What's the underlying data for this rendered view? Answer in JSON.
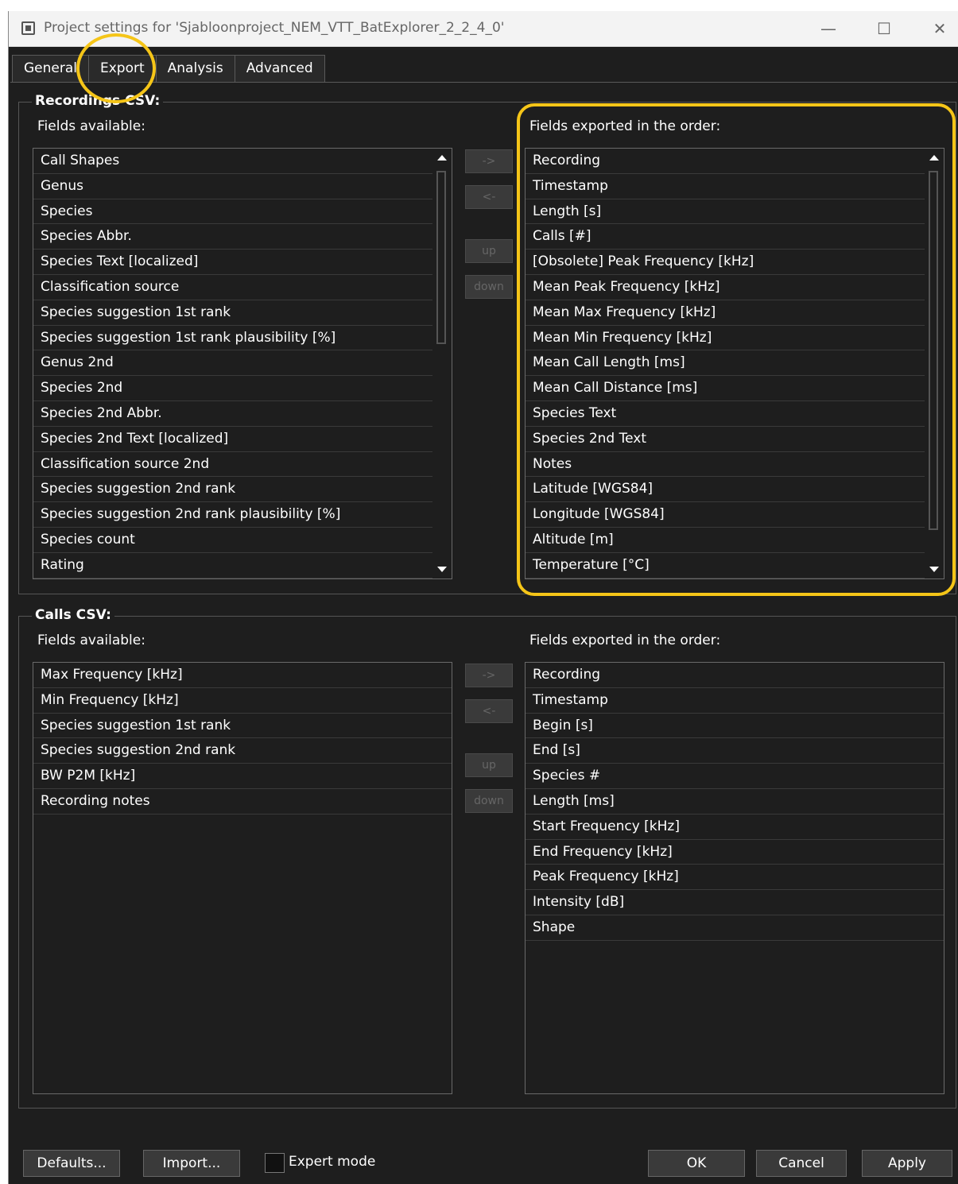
{
  "window": {
    "title": "Project settings for 'Sjabloonproject_NEM_VTT_BatExplorer_2_2_4_0'",
    "minimize": "—",
    "maximize": "☐",
    "close": "✕"
  },
  "tabs": [
    "General",
    "Export",
    "Analysis",
    "Advanced"
  ],
  "recordings": {
    "title": "Recordings CSV:",
    "available_label": "Fields available:",
    "exported_label": "Fields exported in the order:",
    "available": [
      "Call Shapes",
      "Genus",
      "Species",
      "Species Abbr.",
      "Species Text [localized]",
      "Classification source",
      "Species suggestion 1st rank",
      "Species suggestion 1st rank plausibility [%]",
      "Genus 2nd",
      "Species 2nd",
      "Species 2nd Abbr.",
      "Species 2nd Text [localized]",
      "Classification source 2nd",
      "Species suggestion 2nd rank",
      "Species suggestion 2nd rank plausibility [%]",
      "Species count",
      "Rating"
    ],
    "exported": [
      "Recording",
      "Timestamp",
      "Length [s]",
      "Calls [#]",
      "[Obsolete] Peak Frequency [kHz]",
      "Mean Peak Frequency [kHz]",
      "Mean Max Frequency [kHz]",
      "Mean Min Frequency [kHz]",
      "Mean Call Length [ms]",
      "Mean Call Distance [ms]",
      "Species Text",
      "Species 2nd Text",
      "Notes",
      "Latitude [WGS84]",
      "Longitude [WGS84]",
      "Altitude [m]",
      "Temperature [°C]"
    ]
  },
  "calls": {
    "title": "Calls CSV:",
    "available_label": "Fields available:",
    "exported_label": "Fields exported in the order:",
    "available": [
      "Max Frequency [kHz]",
      "Min Frequency [kHz]",
      "Species suggestion 1st rank",
      "Species suggestion 2nd rank",
      "BW P2M [kHz]",
      "Recording notes"
    ],
    "exported": [
      "Recording",
      "Timestamp",
      "Begin [s]",
      "End [s]",
      "Species #",
      "Length [ms]",
      "Start Frequency [kHz]",
      "End Frequency [kHz]",
      "Peak Frequency [kHz]",
      "Intensity [dB]",
      "Shape"
    ]
  },
  "move_buttons": {
    "add": "->",
    "remove": "<-",
    "up": "up",
    "down": "down"
  },
  "footer": {
    "defaults": "Defaults...",
    "import": "Import...",
    "expert_mode": "Expert mode",
    "ok": "OK",
    "cancel": "Cancel",
    "apply": "Apply"
  },
  "colors": {
    "highlight": "#f5c518",
    "background": "#1e1e1e"
  }
}
